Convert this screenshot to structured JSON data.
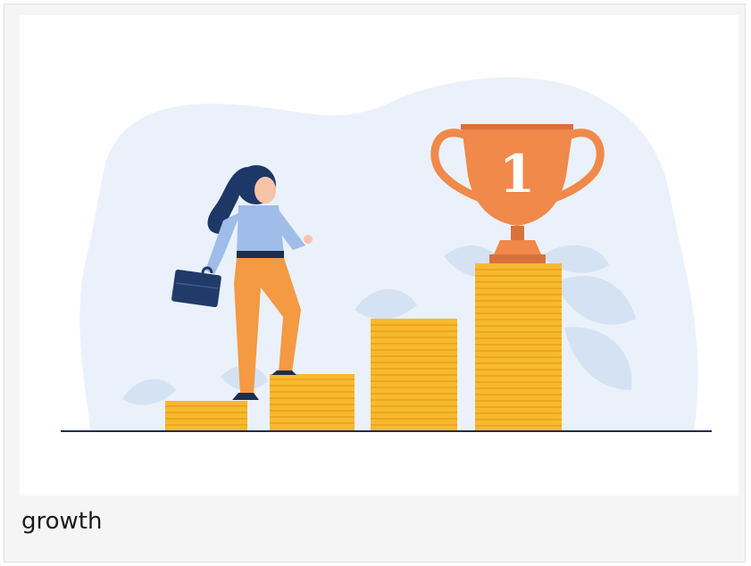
{
  "card": {
    "caption": "growth"
  },
  "illustration": {
    "trophy_label": "1",
    "colors": {
      "blob": "#eaf1fa",
      "leaf": "#d4e2f3",
      "coin": "#f7b92e",
      "coin_edge": "#e59c1c",
      "trophy": "#f0894a",
      "trophy_dark": "#d9713a",
      "ground": "#1f2d4d",
      "shirt": "#9fbde8",
      "pants": "#f39a43",
      "hair": "#1d3766",
      "briefcase": "#213a6a"
    },
    "coin_stacks": [
      {
        "name": "stack-1",
        "coins": 5
      },
      {
        "name": "stack-2",
        "coins": 10
      },
      {
        "name": "stack-3",
        "coins": 18
      },
      {
        "name": "stack-4",
        "coins": 28
      }
    ]
  }
}
